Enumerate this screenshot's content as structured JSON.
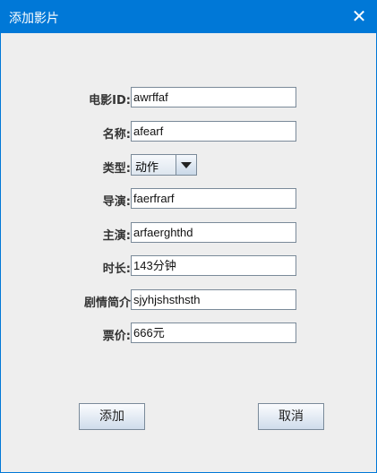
{
  "window": {
    "title": "添加影片",
    "close": "✕"
  },
  "fields": [
    {
      "label": "电影ID:",
      "value": "awrffaf"
    },
    {
      "label": "名称:",
      "value": "afearf"
    },
    {
      "label": "导演:",
      "value": "faerfrarf"
    },
    {
      "label": "主演:",
      "value": "arfaerghthd"
    },
    {
      "label": "时长:",
      "value": "143分钟"
    },
    {
      "label": "剧情简介",
      "value": "sjyhjshsthsth"
    },
    {
      "label": "票价:",
      "value": "666元"
    }
  ],
  "type": {
    "label": "类型:",
    "value": "动作"
  },
  "buttons": {
    "add": "添加",
    "cancel": "取消"
  }
}
